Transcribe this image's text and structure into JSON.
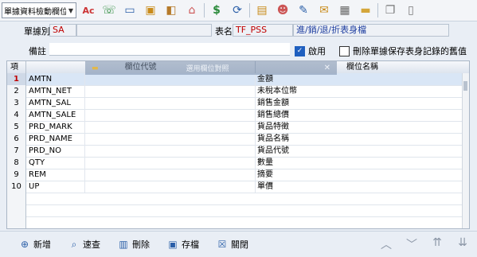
{
  "toolbar": {
    "combo_text": "單據資料檢動欄位",
    "icons": [
      "abc-icon",
      "phone-icon",
      "monitor-icon",
      "lock-icon",
      "briefcase-icon",
      "home-icon",
      "dollar-icon",
      "refresh-icon",
      "clipboard-icon",
      "users-icon",
      "edit-icon",
      "mail-icon",
      "calculator-icon",
      "folder-icon",
      "copy-icon",
      "document-icon"
    ]
  },
  "form": {
    "doc_type_label": "單據別",
    "doc_type_value": "SA",
    "table_label": "表名",
    "table_value": "TF_PSS",
    "table_desc": "進/銷/退/折表身檔",
    "note_label": "備註",
    "enabled_label": "啟用",
    "enabled_checked": true,
    "delete_label": "刪除單據保存表身記錄的舊值",
    "delete_checked": false
  },
  "grid": {
    "headers": {
      "num": "項",
      "code": "欄位代號",
      "name": "欄位名稱"
    },
    "overlay_text": "選用欄位對照",
    "rows": [
      {
        "num": "1",
        "code": "AMTN",
        "name": "金額"
      },
      {
        "num": "2",
        "code": "AMTN_NET",
        "name": "未稅本位幣"
      },
      {
        "num": "3",
        "code": "AMTN_SAL",
        "name": "銷售金額"
      },
      {
        "num": "4",
        "code": "AMTN_SALE",
        "name": "銷售總價"
      },
      {
        "num": "5",
        "code": "PRD_MARK",
        "name": "貨品特徵"
      },
      {
        "num": "6",
        "code": "PRD_NAME",
        "name": "貨品名稱"
      },
      {
        "num": "7",
        "code": "PRD_NO",
        "name": "貨品代號"
      },
      {
        "num": "8",
        "code": "QTY",
        "name": "數量"
      },
      {
        "num": "9",
        "code": "REM",
        "name": "摘要"
      },
      {
        "num": "10",
        "code": "UP",
        "name": "單價"
      }
    ]
  },
  "bottom": {
    "add": "新增",
    "query": "速查",
    "delete": "刪除",
    "save": "存檔",
    "close": "關閉"
  },
  "colors": {
    "accent": "#1f5fbf",
    "selected_row": "#d9e6f6"
  }
}
